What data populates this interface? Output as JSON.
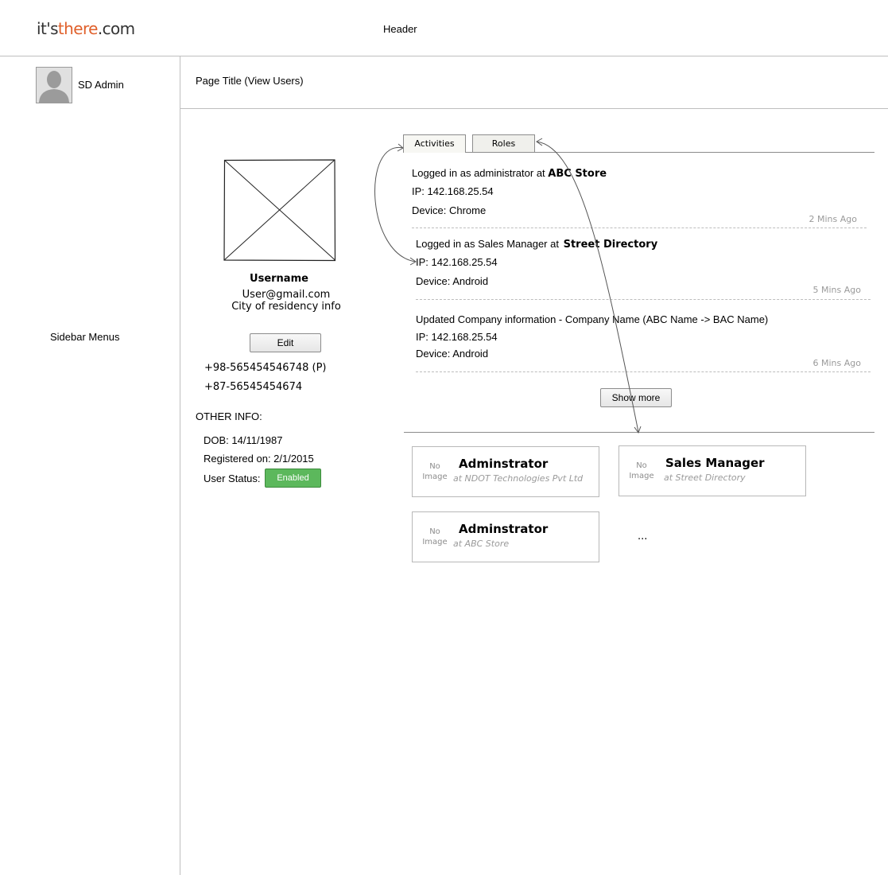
{
  "header": {
    "logo_part1": "it's",
    "logo_part2": "there",
    "logo_part3": ".com",
    "label": "Header"
  },
  "sidebar": {
    "user_name": "SD Admin",
    "menus_label": "Sidebar Menus"
  },
  "page_title": "Page Title (View Users)",
  "profile": {
    "username": "Username",
    "email": "User@gmail.com",
    "city": "City of residency info",
    "edit_label": "Edit",
    "phones": [
      "+98-565454546748 (P)",
      "+87-56545454674"
    ],
    "other_info_heading": "OTHER INFO:",
    "dob": "DOB: 14/11/1987",
    "registered": "Registered on: 2/1/2015",
    "status_label": "User Status:",
    "status_value": "Enabled"
  },
  "tabs": {
    "activities": "Activities",
    "roles": "Roles"
  },
  "activities": [
    {
      "prefix": "Logged in as administrator at",
      "entity": "ABC Store",
      "ip": "IP: 142.168.25.54",
      "device": "Device: Chrome",
      "ago": "2 Mins Ago"
    },
    {
      "prefix": "Logged in as Sales Manager at",
      "entity": "Street Directory",
      "ip": "IP: 142.168.25.54",
      "device": "Device: Android",
      "ago": "5 Mins Ago"
    },
    {
      "prefix": "Updated Company information - Company Name (ABC Name -> BAC Name)",
      "entity": "",
      "ip": "IP: 142.168.25.54",
      "device": "Device: Android",
      "ago": "6 Mins Ago"
    }
  ],
  "show_more_label": "Show more",
  "roles": [
    {
      "no_image_1": "No",
      "no_image_2": "Image",
      "title": "Adminstrator",
      "org": "at NDOT Technologies Pvt Ltd"
    },
    {
      "no_image_1": "No",
      "no_image_2": "Image",
      "title": "Sales Manager",
      "org": "at Street Directory"
    },
    {
      "no_image_1": "No",
      "no_image_2": "Image",
      "title": "Adminstrator",
      "org": "at ABC Store"
    }
  ],
  "roles_more": "...",
  "colors": {
    "logo_accent": "#e0602b",
    "status_enabled": "#5cb85c"
  }
}
